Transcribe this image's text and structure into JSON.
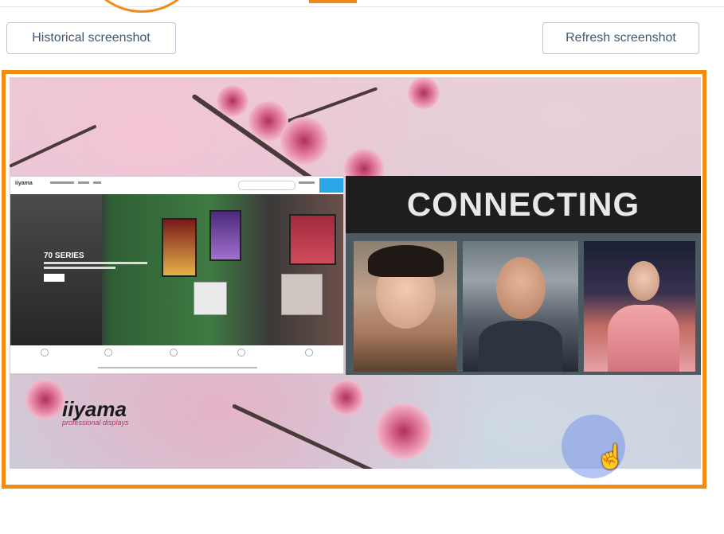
{
  "toolbar": {
    "historical_label": "Historical screenshot",
    "refresh_label": "Refresh screenshot"
  },
  "screenshot": {
    "connect_heading": "CONNECTING",
    "brand_name": "iiyama",
    "brand_tagline": "professional displays",
    "website_hero_title": "70 SERIES"
  },
  "icons": {
    "cursor": "hand-pointer-icon"
  },
  "colors": {
    "highlight": "#f28a14",
    "button_border": "#b9c6d2",
    "button_text": "#41576d",
    "cursor_halo": "#7896eb"
  }
}
